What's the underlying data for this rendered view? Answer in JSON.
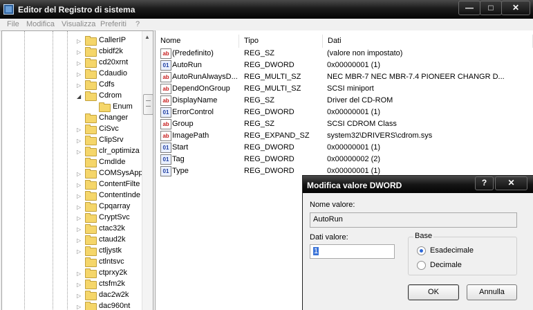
{
  "window": {
    "title": "Editor del Registro di sistema",
    "minimize_glyph": "—",
    "maximize_glyph": "□",
    "close_glyph": "✕"
  },
  "menu": [
    "File",
    "Modifica",
    "Visualizza",
    "Preferiti",
    "?"
  ],
  "tree": {
    "items": [
      "CallerIP",
      "cbidf2k",
      "cd20xrnt",
      "Cdaudio",
      "Cdfs",
      "Cdrom",
      "Enum",
      "Changer",
      "CiSvc",
      "ClipSrv",
      "clr_optimiza",
      "CmdIde",
      "COMSysApp",
      "ContentFilte",
      "ContentInde",
      "Cpqarray",
      "CryptSvc",
      "ctac32k",
      "ctaud2k",
      "ctljystk",
      "ctlntsvc",
      "ctprxy2k",
      "ctsfm2k",
      "dac2w2k",
      "dac960nt"
    ]
  },
  "list": {
    "headers": [
      "Nome",
      "Tipo",
      "Dati"
    ],
    "rows": [
      {
        "icon": "string-value-icon",
        "glyph": "ab",
        "name": "(Predefinito)",
        "type": "REG_SZ",
        "data": "(valore non impostato)"
      },
      {
        "icon": "binary-value-icon",
        "glyph": "01",
        "name": "AutoRun",
        "type": "REG_DWORD",
        "data": "0x00000001 (1)"
      },
      {
        "icon": "string-value-icon",
        "glyph": "ab",
        "name": "AutoRunAlwaysD...",
        "type": "REG_MULTI_SZ",
        "data": "NEC    MBR-7   NEC    MBR-7.4  PIONEER CHANGR D..."
      },
      {
        "icon": "string-value-icon",
        "glyph": "ab",
        "name": "DependOnGroup",
        "type": "REG_MULTI_SZ",
        "data": "SCSI miniport"
      },
      {
        "icon": "string-value-icon",
        "glyph": "ab",
        "name": "DisplayName",
        "type": "REG_SZ",
        "data": "Driver del CD-ROM"
      },
      {
        "icon": "binary-value-icon",
        "glyph": "01",
        "name": "ErrorControl",
        "type": "REG_DWORD",
        "data": "0x00000001 (1)"
      },
      {
        "icon": "string-value-icon",
        "glyph": "ab",
        "name": "Group",
        "type": "REG_SZ",
        "data": "SCSI CDROM Class"
      },
      {
        "icon": "string-value-icon",
        "glyph": "ab",
        "name": "ImagePath",
        "type": "REG_EXPAND_SZ",
        "data": "system32\\DRIVERS\\cdrom.sys"
      },
      {
        "icon": "binary-value-icon",
        "glyph": "01",
        "name": "Start",
        "type": "REG_DWORD",
        "data": "0x00000001 (1)"
      },
      {
        "icon": "binary-value-icon",
        "glyph": "01",
        "name": "Tag",
        "type": "REG_DWORD",
        "data": "0x00000002 (2)"
      },
      {
        "icon": "binary-value-icon",
        "glyph": "01",
        "name": "Type",
        "type": "REG_DWORD",
        "data": "0x00000001 (1)"
      }
    ]
  },
  "dialog": {
    "title": "Modifica valore DWORD",
    "help_glyph": "?",
    "close_glyph": "✕",
    "name_label": "Nome valore:",
    "name_value": "AutoRun",
    "data_label": "Dati valore:",
    "data_value": "1",
    "base_label": "Base",
    "hex_label": "Esadecimale",
    "dec_label": "Decimale",
    "ok_label": "OK",
    "cancel_label": "Annulla"
  }
}
